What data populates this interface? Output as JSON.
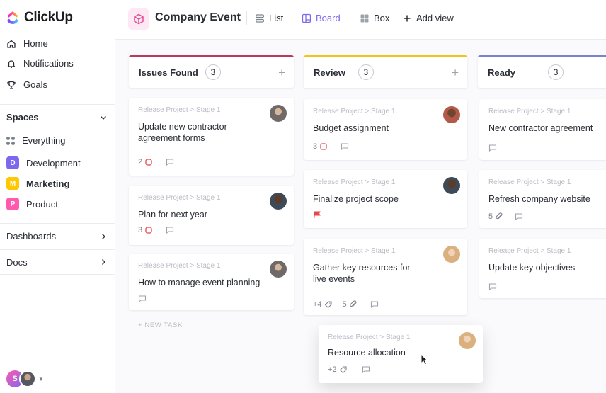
{
  "app": {
    "logo_text": "ClickUp"
  },
  "sidebar": {
    "nav": [
      {
        "label": "Home",
        "icon": "home-icon"
      },
      {
        "label": "Notifications",
        "icon": "bell-icon"
      },
      {
        "label": "Goals",
        "icon": "trophy-icon"
      }
    ],
    "spaces_label": "Spaces",
    "everything_label": "Everything",
    "spaces": [
      {
        "badge": "D",
        "label": "Development",
        "color": "#7b68ee"
      },
      {
        "badge": "M",
        "label": "Marketing",
        "color": "#ffc800"
      },
      {
        "badge": "P",
        "label": "Product",
        "color": "#ff5ab0"
      }
    ],
    "dashboards_label": "Dashboards",
    "docs_label": "Docs",
    "user_initial": "S"
  },
  "header": {
    "project_title": "Company Event",
    "views": [
      {
        "label": "List",
        "icon": "list-icon"
      },
      {
        "label": "Board",
        "icon": "board-icon",
        "active": true
      },
      {
        "label": "Box",
        "icon": "box-icon"
      },
      {
        "label": "Add view",
        "icon": "plus-icon"
      }
    ]
  },
  "board": {
    "columns": [
      {
        "name": "Issues Found",
        "count": "3",
        "color": "#b83b5e",
        "cards": [
          {
            "path": "Release Project > Stage 1",
            "title": "Update new contractor agreement forms",
            "subtasks": "2",
            "avatar": "m1"
          },
          {
            "path": "Release Project > Stage 1",
            "title": "Plan for next year",
            "subtasks": "3",
            "avatar": "m2"
          },
          {
            "path": "Release Project > Stage 1",
            "title": "How to manage event planning",
            "avatar": "m1"
          }
        ],
        "new_task_label": "+ NEW TASK"
      },
      {
        "name": "Review",
        "count": "3",
        "color": "#f0c419",
        "cards": [
          {
            "path": "Release Project > Stage 1",
            "title": "Budget assignment",
            "subtasks": "3",
            "avatar": "f1"
          },
          {
            "path": "Release Project > Stage 1",
            "title": "Finalize project scope",
            "avatar": "m2"
          },
          {
            "path": "Release Project > Stage 1",
            "title": "Gather key resources for live events",
            "tags": "+4",
            "attachments": "5",
            "avatar": "f2"
          }
        ]
      },
      {
        "name": "Ready",
        "count": "3",
        "color": "#7b84c9",
        "cards": [
          {
            "path": "Release Project > Stage 1",
            "title": "New contractor agreement"
          },
          {
            "path": "Release Project > Stage 1",
            "title": "Refresh company website",
            "attachments": "5"
          },
          {
            "path": "Release Project > Stage 1",
            "title": "Update key objectives"
          }
        ]
      }
    ],
    "dragging_card": {
      "path": "Release Project > Stage 1",
      "title": "Resource allocation",
      "tags": "+2",
      "avatar": "f2"
    }
  }
}
